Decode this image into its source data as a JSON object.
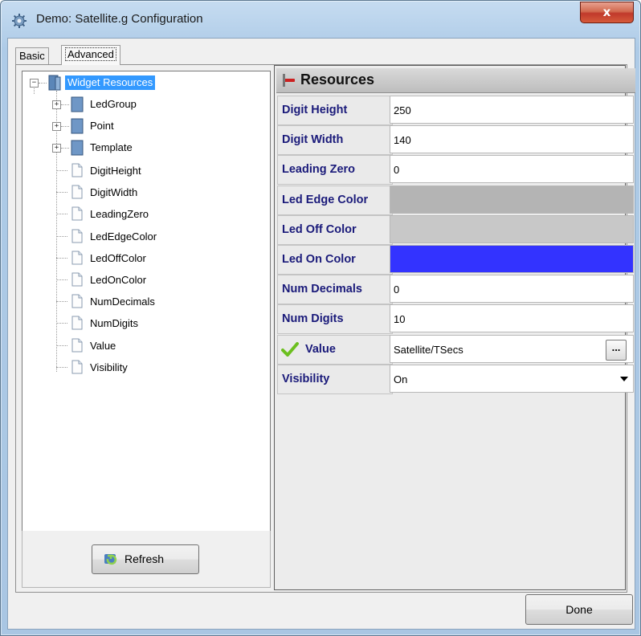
{
  "window": {
    "title": "Demo: Satellite.g Configuration",
    "close_label": "x"
  },
  "tabs": {
    "basic": "Basic",
    "advanced": "Advanced"
  },
  "tree": {
    "root": "Widget Resources",
    "folders": [
      "LedGroup",
      "Point",
      "Template"
    ],
    "leaves": [
      "DigitHeight",
      "DigitWidth",
      "LeadingZero",
      "LedEdgeColor",
      "LedOffColor",
      "LedOnColor",
      "NumDecimals",
      "NumDigits",
      "Value",
      "Visibility"
    ]
  },
  "refresh_label": "Refresh",
  "resources": {
    "header": "Resources",
    "rows": [
      {
        "name": "Digit Height",
        "value": "250"
      },
      {
        "name": "Digit Width",
        "value": "140"
      },
      {
        "name": "Leading Zero",
        "value": "0"
      },
      {
        "name": "Led Edge Color",
        "value": "",
        "color": "#b4b4b4"
      },
      {
        "name": "Led Off Color",
        "value": "",
        "color": "#c8c8c8"
      },
      {
        "name": "Led On Color",
        "value": "",
        "color": "#3333ff"
      },
      {
        "name": "Num Decimals",
        "value": "0"
      },
      {
        "name": "Num Digits",
        "value": "10"
      },
      {
        "name": "Value",
        "value": "Satellite/TSecs",
        "button": "..."
      },
      {
        "name": "Visibility",
        "value": "On"
      }
    ]
  },
  "done_label": "Done"
}
